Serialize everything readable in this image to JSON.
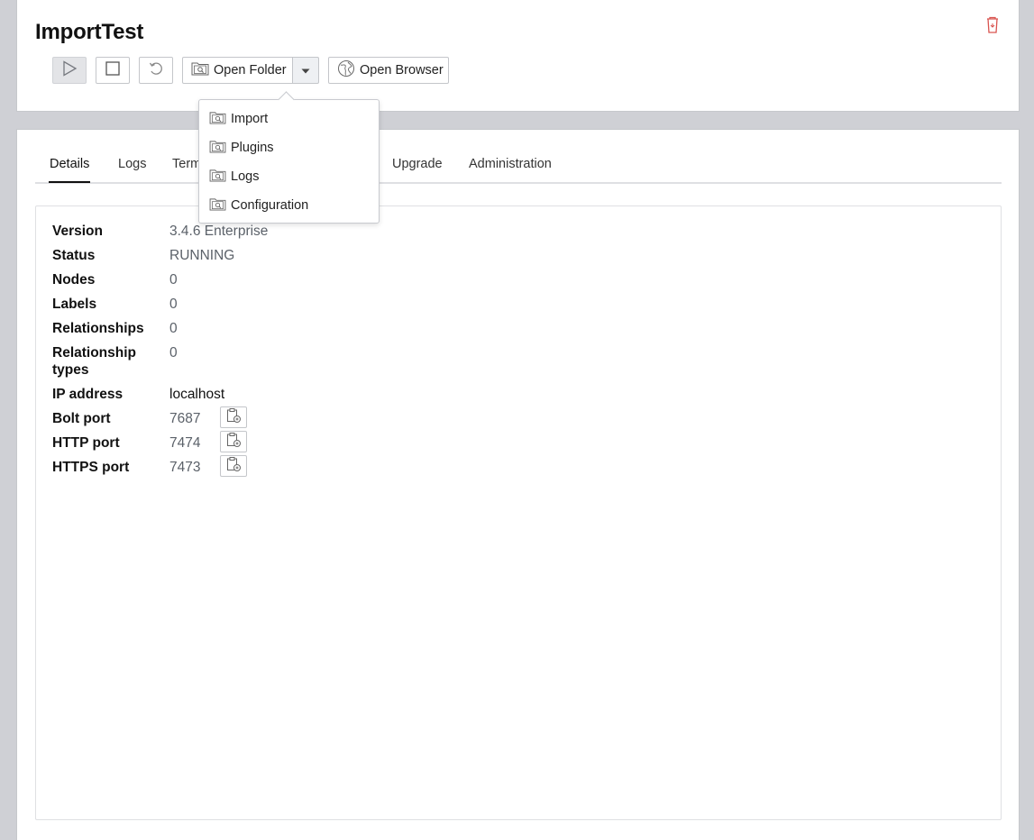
{
  "header": {
    "title": "ImportTest",
    "buttons": {
      "open_folder": "Open Folder",
      "open_browser": "Open Browser"
    }
  },
  "dropdown": {
    "items": [
      {
        "label": "Import",
        "icon": "folder-search-icon"
      },
      {
        "label": "Plugins",
        "icon": "folder-search-icon"
      },
      {
        "label": "Logs",
        "icon": "folder-search-icon"
      },
      {
        "label": "Configuration",
        "icon": "folder-search-icon"
      }
    ]
  },
  "tabs": [
    {
      "label": "Details",
      "active": true
    },
    {
      "label": "Logs",
      "active": false
    },
    {
      "label": "Term",
      "active": false
    },
    {
      "label": "Upgrade",
      "active": false
    },
    {
      "label": "Administration",
      "active": false
    }
  ],
  "details": [
    {
      "label": "Version",
      "value": "3.4.6 Enterprise"
    },
    {
      "label": "Status",
      "value": "RUNNING"
    },
    {
      "label": "Nodes",
      "value": "0"
    },
    {
      "label": "Labels",
      "value": "0"
    },
    {
      "label": "Relationships",
      "value": "0"
    },
    {
      "label": "Relationship types",
      "value": "0"
    },
    {
      "label": "IP address",
      "value": "localhost"
    },
    {
      "label": "Bolt port",
      "value": "7687"
    },
    {
      "label": "HTTP port",
      "value": "7474"
    },
    {
      "label": "HTTPS port",
      "value": "7473"
    }
  ],
  "colors": {
    "background": "#cfd0d5",
    "trash_icon": "#d9534f"
  }
}
